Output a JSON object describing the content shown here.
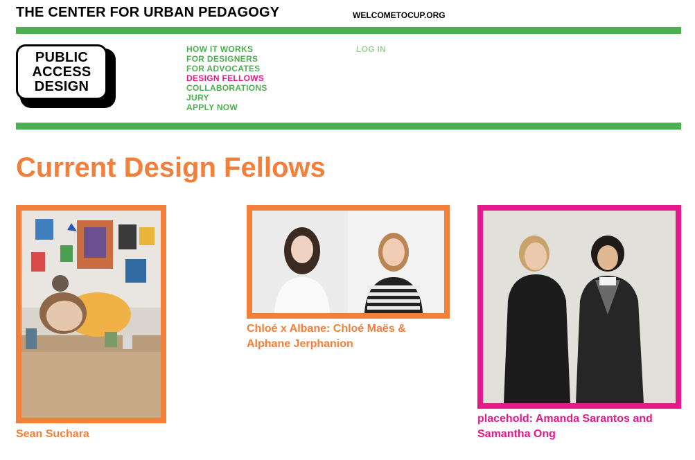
{
  "header": {
    "org_title": "THE CENTER FOR URBAN PEDAGOGY",
    "org_link": "WELCOMETOCUP.ORG"
  },
  "logo": {
    "lines": [
      "PUBLIC",
      "ACCESS",
      "DESIGN"
    ]
  },
  "nav": {
    "items": [
      {
        "label": "HOW IT WORKS"
      },
      {
        "label": "FOR DESIGNERS"
      },
      {
        "label": "FOR ADVOCATES"
      },
      {
        "label": "DESIGN FELLOWS"
      },
      {
        "label": "COLLABORATIONS"
      },
      {
        "label": "JURY"
      },
      {
        "label": "APPLY NOW"
      }
    ],
    "active_label": "DESIGN FELLOWS",
    "login": "LOG IN"
  },
  "main": {
    "heading": "Current Design Fellows",
    "fellows": [
      {
        "caption": "Sean Suchara"
      },
      {
        "caption": "Chloé x Albane: Chloé Maës & Alphane Jerphanion"
      },
      {
        "caption": "placehold: Amanda Sarantos and Samantha Ong"
      }
    ]
  },
  "colors": {
    "green": "#4caf50",
    "light_green": "#9fd39c",
    "orange": "#f47f3a",
    "pink": "#e6198a"
  }
}
